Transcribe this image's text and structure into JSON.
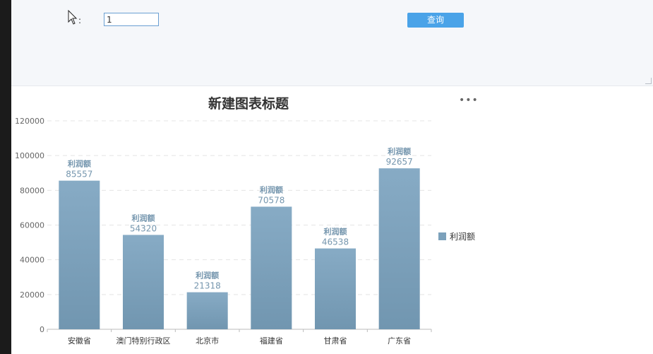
{
  "filter": {
    "field_label": ":",
    "input_value": "1",
    "query_button": "查询"
  },
  "chart_menu_icon": "more-horizontal-icon",
  "colors": {
    "bar": "#7ca1bb",
    "accent_button": "#4aa3e8",
    "data_label": "#7596ae"
  },
  "chart_data": {
    "type": "bar",
    "title": "新建图表标题",
    "categories": [
      "安徽省",
      "澳门特别行政区",
      "北京市",
      "福建省",
      "甘肃省",
      "广东省"
    ],
    "series": [
      {
        "name": "利润额",
        "values": [
          85557,
          54320,
          21318,
          70578,
          46538,
          92657
        ]
      }
    ],
    "ylim": [
      0,
      120000
    ],
    "yticks": [
      "0",
      "20000",
      "40000",
      "60000",
      "80000",
      "100000",
      "120000"
    ],
    "grid": true,
    "legend": "right"
  }
}
